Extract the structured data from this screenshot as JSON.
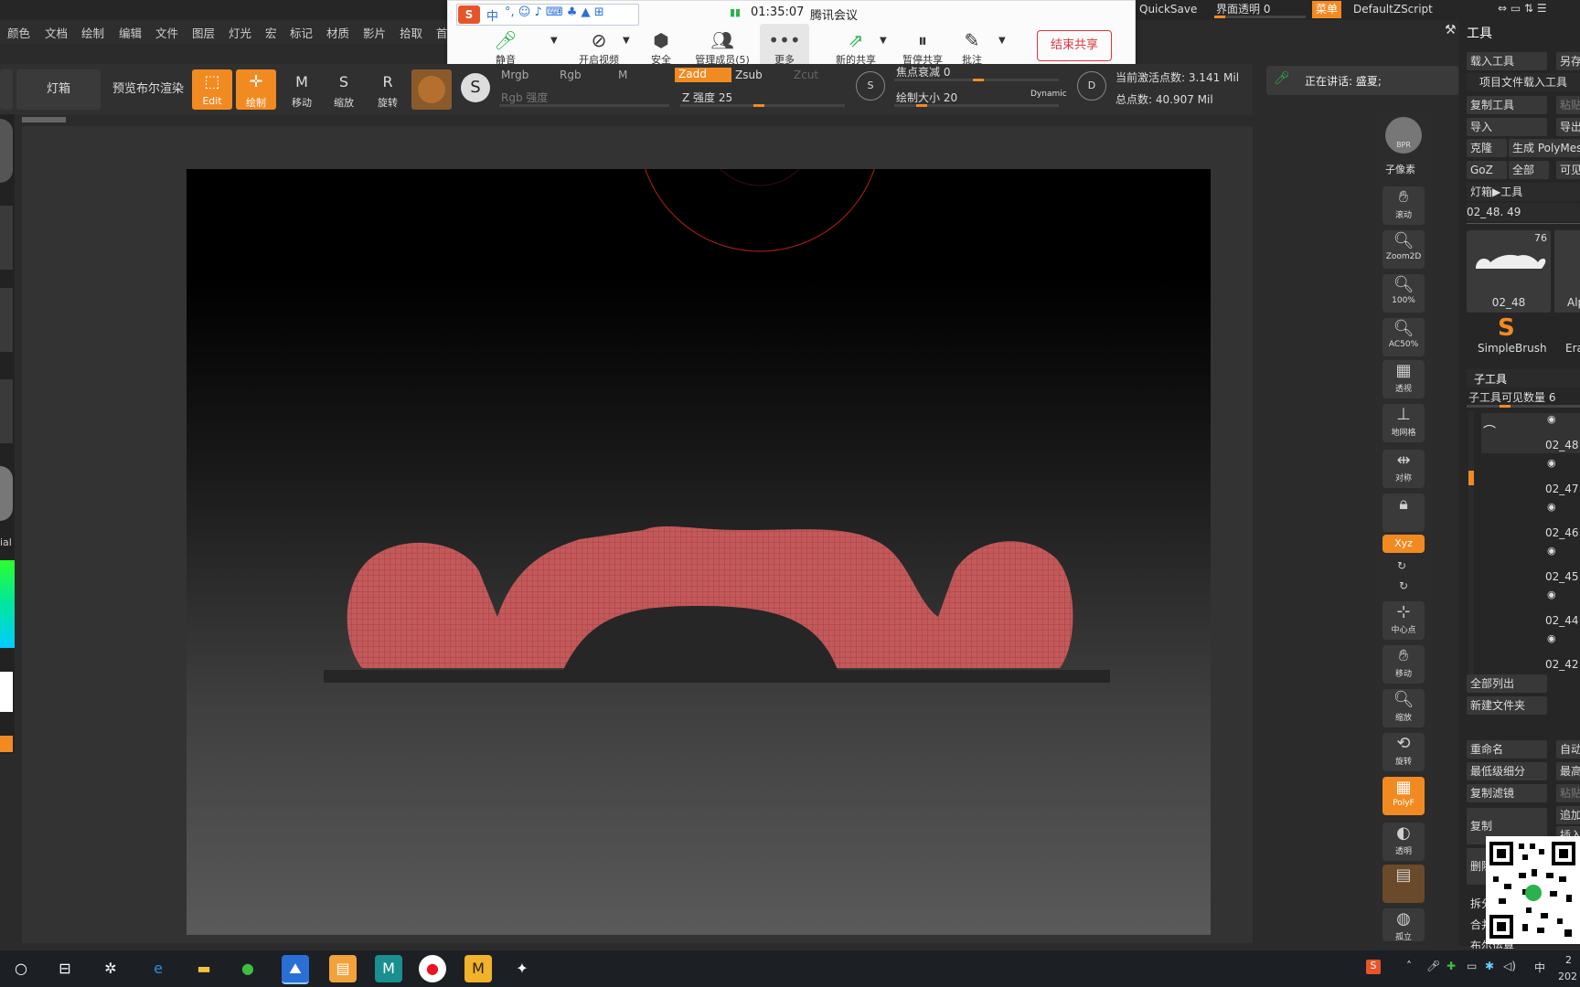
{
  "menubar": {
    "items": [
      "颜色",
      "文档",
      "绘制",
      "编辑",
      "文件",
      "图层",
      "灯光",
      "宏",
      "标记",
      "材质",
      "影片",
      "拾取",
      "首"
    ]
  },
  "topbar_right": {
    "quicksave": "QuickSave",
    "ui_transparency": "界面透明 0",
    "menu": "菜单",
    "script": "DefaultZScript",
    "tool_title": "工具"
  },
  "meeting": {
    "time": "01:35:07",
    "title": "腾讯会议",
    "ime_text": "中",
    "buttons": [
      "静音",
      "开启视频",
      "安全",
      "管理成员(5)",
      "更多",
      "新的共享",
      "暂停共享",
      "批注"
    ],
    "end_share": "结束共享"
  },
  "toolbar": {
    "lightbox": "灯箱",
    "preview_bool": "预览布尔渲染",
    "edit": "Edit",
    "draw": "绘制",
    "move": "移动",
    "scale": "缩放",
    "rotate": "旋转",
    "mrgb": "Mrgb",
    "rgb": "Rgb",
    "m": "M",
    "zadd": "Zadd",
    "zsub": "Zsub",
    "zcut": "Zcut",
    "rgb_intensity": "Rgb 强度",
    "z_intensity": "Z 强度 25",
    "focal_shift": "焦点衰减 0",
    "draw_size": "绘制大小 20",
    "dynamic": "Dynamic",
    "active_points": "当前激活点数: 3.141 Mil",
    "total_points": "总点数: 40.907 Mil"
  },
  "speaking": "正在讲话: 盛夏;",
  "shelf": {
    "items": [
      "BPR",
      "子像素",
      "滚动",
      "Zoom2D",
      "100%",
      "AC50%",
      "透视",
      "地网格",
      "对称",
      "",
      "Xyz",
      "",
      "",
      "中心点",
      "移动",
      "缩放",
      "旋转",
      "PolyF",
      "透明",
      "",
      "孤立"
    ]
  },
  "right_panel": {
    "load_tool": "载入工具",
    "save_as": "另存",
    "load_project_tool": "项目文件载入工具",
    "copy_tool": "复制工具",
    "paste": "粘贴",
    "import": "导入",
    "export": "导出",
    "clone": "克隆",
    "make_polymesh": "生成 PolyMesh",
    "goz": "GoZ",
    "all": "全部",
    "visible": "可见",
    "lightbox_tool": "灯箱▶工具",
    "current_tool": "02_48. 49",
    "thumb_count": "76",
    "thumb_name": "02_48",
    "simplebrush": "SimpleBrush",
    "eraser": "Era",
    "alpha": "Alp",
    "subtool": "子工具",
    "subtool_visible": "子工具可见数量 6",
    "subtools": [
      "02_48",
      "02_47",
      "02_46",
      "02_45",
      "02_44",
      "02_42"
    ],
    "list_all": "全部列出",
    "new_folder": "新建文件夹",
    "rename": "重命名",
    "auto": "自动",
    "lowest_sub": "最低级细分",
    "highest": "最高",
    "copy_filter": "复制滤镜",
    "paste2": "粘贴",
    "duplicate": "复制",
    "append": "追加",
    "insert": "插入",
    "delete": "删除",
    "split": "拆分",
    "merge": "合并",
    "boolean": "布尔运算"
  },
  "left_strip": {
    "label": "ial"
  },
  "taskbar": {
    "ime": "中",
    "year": "202",
    "num": "2"
  },
  "colors": {
    "accent": "#f28a22",
    "mesh": "#c4595b",
    "meeting_end": "#d9363e"
  }
}
